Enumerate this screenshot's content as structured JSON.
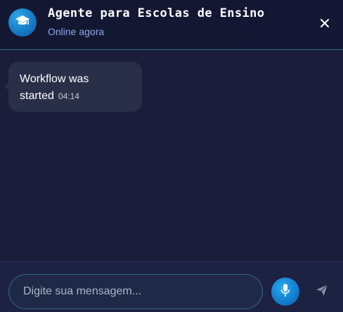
{
  "header": {
    "title": "Agente para Escolas de Ensino",
    "status": "Online agora",
    "avatar_icon": "graduation-cap-icon",
    "close_icon": "close-icon"
  },
  "messages": [
    {
      "text": "Workflow was started",
      "time": "04:14"
    }
  ],
  "composer": {
    "placeholder": "Digite sua mensagem...",
    "value": "",
    "mic_icon": "microphone-icon",
    "send_icon": "send-icon"
  },
  "colors": {
    "background": "#1b1e3a",
    "header": "#131732",
    "accent": "#1478c2",
    "bubble": "#2a2f48",
    "status_text": "#8fa7e6"
  }
}
